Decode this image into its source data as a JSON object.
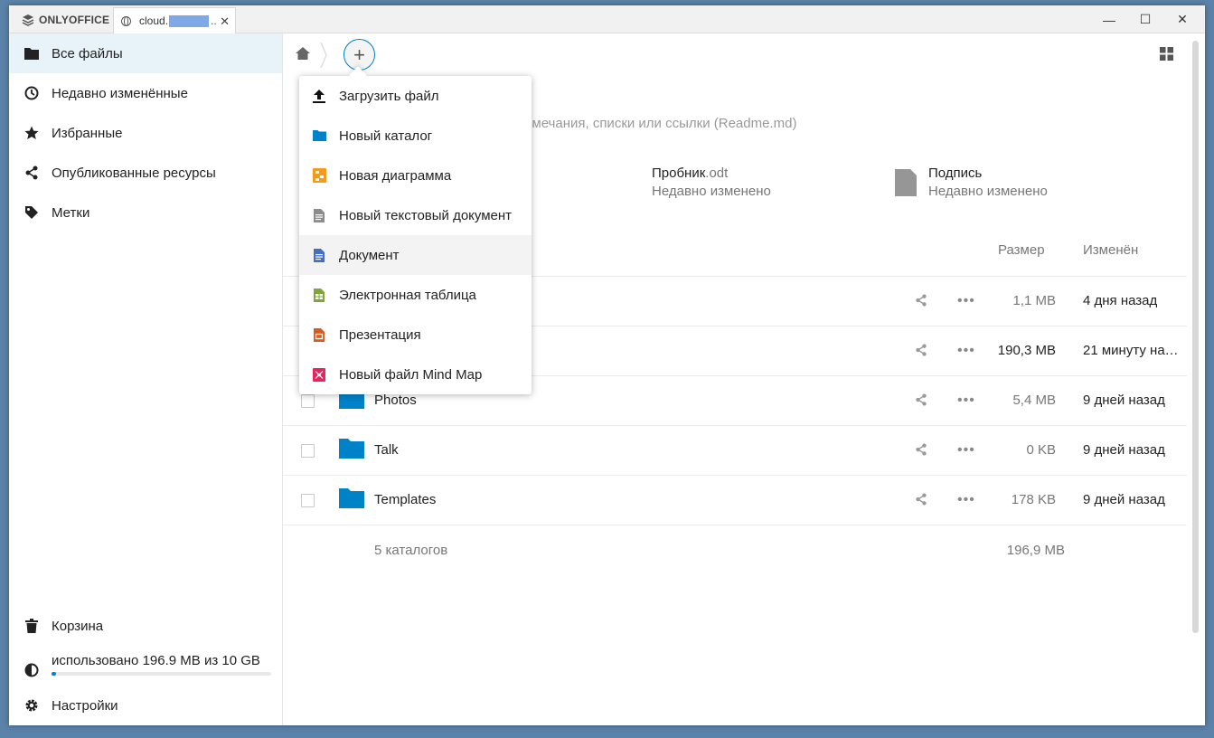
{
  "titlebar": {
    "brand": "ONLYOFFICE",
    "tab_label": "cloud.",
    "tab_ellipsis": "..",
    "close_tab": "✕",
    "minimize": "—",
    "maximize": "☐",
    "close": "✕"
  },
  "sidebar": {
    "items": [
      {
        "label": "Все файлы",
        "icon": "folder-icon"
      },
      {
        "label": "Недавно изменённые",
        "icon": "clock-icon"
      },
      {
        "label": "Избранные",
        "icon": "star-icon"
      },
      {
        "label": "Опубликованные ресурсы",
        "icon": "share-icon"
      },
      {
        "label": "Метки",
        "icon": "tag-icon"
      }
    ],
    "trash": "Корзина",
    "quota": "использовано 196.9 MB из 10 GB",
    "quota_fraction": 0.02,
    "settings": "Настройки"
  },
  "main": {
    "add_symbol": "+",
    "readme_hint": "имечания, списки или ссылки (Readme.md)",
    "recent": [
      {
        "name": "Пробник",
        "ext": ".odt",
        "sub": "Недавно изменено"
      },
      {
        "name": "Подпись",
        "ext": "",
        "sub": "Недавно изменено"
      }
    ],
    "columns": {
      "size": "Размер",
      "modified": "Изменён"
    },
    "rows": [
      {
        "name": "",
        "size": "1,1 MB",
        "modified": "4 дня назад"
      },
      {
        "name": "",
        "size": "190,3 MB",
        "modified": "21 минуту наз…"
      },
      {
        "name": "Photos",
        "size": "5,4 MB",
        "modified": "9 дней назад"
      },
      {
        "name": "Talk",
        "size": "0 KB",
        "modified": "9 дней назад"
      },
      {
        "name": "Templates",
        "size": "178 KB",
        "modified": "9 дней назад"
      }
    ],
    "more_symbol": "•••",
    "summary": {
      "count": "5 каталогов",
      "size": "196,9 MB"
    }
  },
  "menu": {
    "items": [
      {
        "label": "Загрузить файл",
        "icon": "upload-icon"
      },
      {
        "label": "Новый каталог",
        "icon": "folder-icon"
      },
      {
        "label": "Новая диаграмма",
        "icon": "diagram-icon"
      },
      {
        "label": "Новый текстовый документ",
        "icon": "text-file-icon"
      },
      {
        "label": "Документ",
        "icon": "document-icon"
      },
      {
        "label": "Электронная таблица",
        "icon": "spreadsheet-icon"
      },
      {
        "label": "Презентация",
        "icon": "presentation-icon"
      },
      {
        "label": "Новый файл Mind Map",
        "icon": "mindmap-icon"
      }
    ]
  },
  "colors": {
    "accent": "#0082c9",
    "sidebar_active": "#e8f3f9",
    "folder": "#0082c9"
  }
}
